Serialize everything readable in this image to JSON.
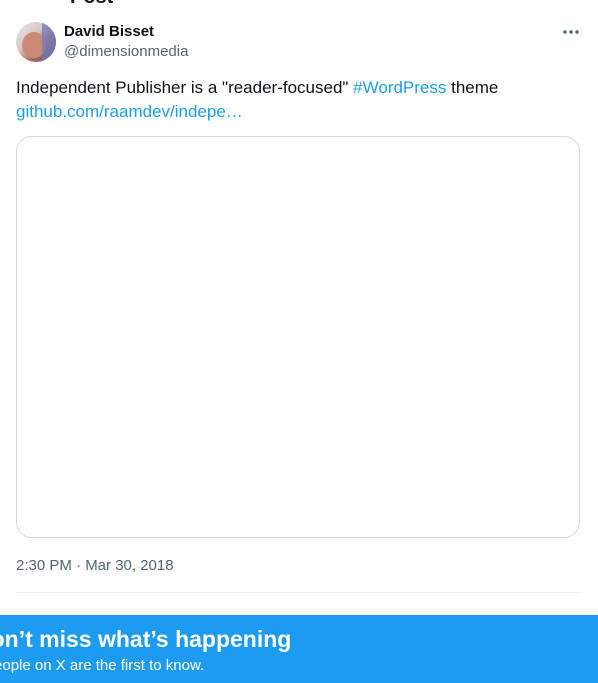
{
  "page": {
    "title": "Post"
  },
  "author": {
    "name": "David Bisset",
    "handle": "@dimensionmedia"
  },
  "post": {
    "text_before": "Independent Publisher is a \"reader-focused\" ",
    "hashtag": "#WordPress",
    "text_after": " theme",
    "link": "github.com/raamdev/indepe…",
    "timestamp": "2:30 PM · Mar 30, 2018"
  },
  "icons": {
    "more": "more-horizontal-icon",
    "avatar": "avatar-image"
  },
  "banner": {
    "title": "Don’t miss what’s happening",
    "subtitle": "People on X are the first to know."
  },
  "colors": {
    "accent": "#1d9bf0",
    "secondary_text": "#536471",
    "border": "#cfd9de"
  }
}
